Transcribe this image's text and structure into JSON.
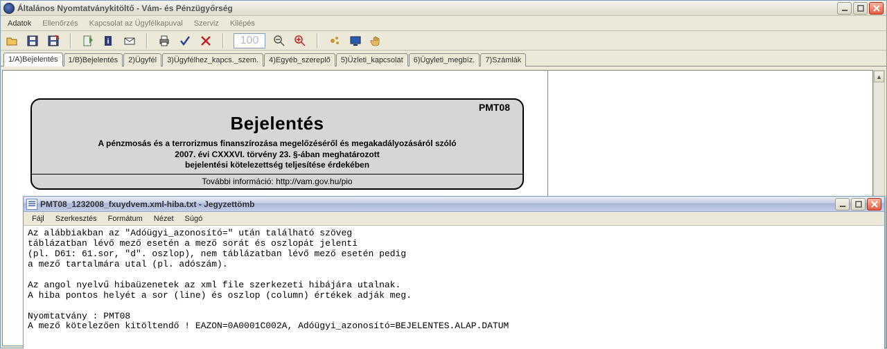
{
  "main": {
    "title": "Általános Nyomtatványkitöltő - Vám- és Pénzügyőrség",
    "menu": [
      "Adatok",
      "Ellenőrzés",
      "Kapcsolat az Ügyfélkapuval",
      "Szerviz",
      "Kilépés"
    ],
    "toolbar": {
      "zoom": "100"
    },
    "tabs": [
      "1/A)Bejelentés",
      "1/B)Bejelentés",
      "2)Ügyfél",
      "3)Ügyfélhez_kapcs._szem.",
      "4)Egyéb_szereplő",
      "5)Üzleti_kapcsolat",
      "6)Ügyleti_megbíz.",
      "7)Számlák"
    ],
    "active_tab": 0,
    "form": {
      "code": "PMT08",
      "title": "Bejelentés",
      "l1": "A pénzmosás és a terrorizmus finanszírozása megelőzéséről és megakadályozásáról szóló",
      "l2": "2007. évi CXXXVI. törvény 23. §-ában meghatározott",
      "l3": "bejelentési kötelezettség teljesítése érdekében",
      "linklabel": "További információ: ",
      "linkurl": "http://vam.gov.hu/pio"
    }
  },
  "notepad": {
    "title": "PMT08_1232008_fxuydvem.xml-hiba.txt - Jegyzettömb",
    "menu": [
      "Fájl",
      "Szerkesztés",
      "Formátum",
      "Nézet",
      "Súgó"
    ],
    "body": "Az alábbiakban az \"Adóügyi_azonosító=\" után található szöveg\ntáblázatban lévő mező esetén a mező sorát és oszlopát jelenti\n(pl. D61: 61.sor, \"d\". oszlop), nem táblázatban lévő mező esetén pedig\na mező tartalmára utal (pl. adószám).\n\nAz angol nyelvű hibaüzenetek az xml file szerkezeti hibájára utalnak.\nA hiba pontos helyét a sor (line) és oszlop (column) értékek adják meg.\n\nNyomtatvány : PMT08\nA mező kötelezően kitöltendő ! EAZON=0A0001C002A, Adóügyi_azonosító=BEJELENTES.ALAP.DATUM"
  }
}
